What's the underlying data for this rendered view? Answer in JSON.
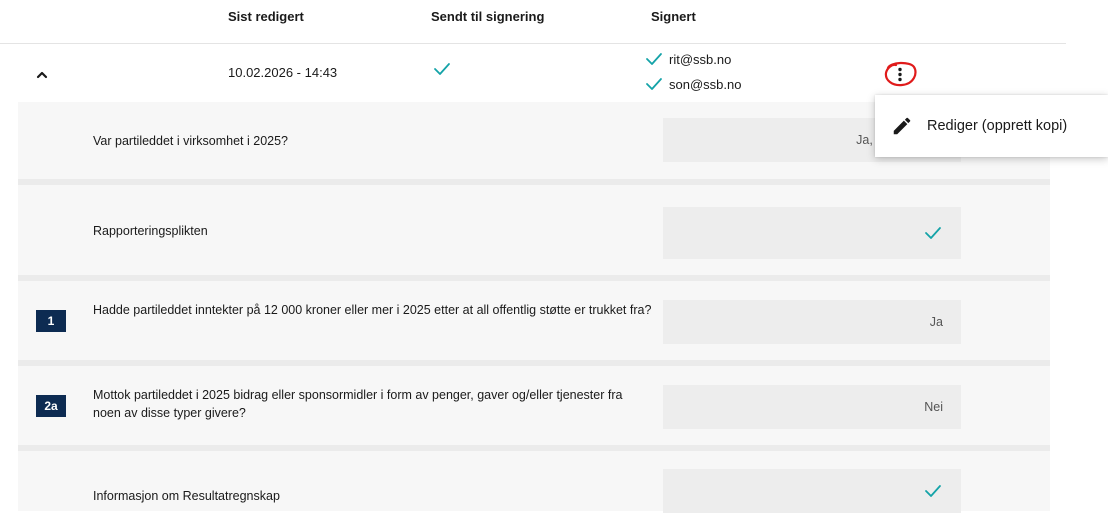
{
  "table": {
    "columns": [
      "Sist redigert",
      "Sendt til signering",
      "Signert"
    ]
  },
  "summary": {
    "last_edited": "10.02.2026 - 14:43",
    "sent_for_signing": true,
    "signers": [
      "rit@ssb.no",
      "son@ssb.no"
    ]
  },
  "menu": {
    "items": [
      {
        "label": "Rediger (opprett kopi)",
        "icon": "pencil-icon"
      }
    ]
  },
  "questions": [
    {
      "badge": "",
      "text": "Var partileddet i virksomhet i 2025?",
      "answer": "Ja, i virksomhet"
    },
    {
      "badge": "",
      "text": "Rapporteringsplikten",
      "answer": "check"
    },
    {
      "badge": "1",
      "text": "Hadde partileddet inntekter på 12 000 kroner eller mer i 2025 etter at all offentlig støtte er trukket fra?",
      "answer": "Ja"
    },
    {
      "badge": "2a",
      "text": "Mottok partileddet i 2025 bidrag eller sponsormidler i form av penger, gaver og/eller tjenester fra noen av disse typer givere?",
      "answer": "Nei"
    },
    {
      "badge": "",
      "text": "Informasjon om Resultatregnskap",
      "answer": "check"
    }
  ],
  "colors": {
    "accent_check": "#14a3a8",
    "badge_bg": "#0d2b52",
    "annotation_red": "#e01b1b"
  }
}
